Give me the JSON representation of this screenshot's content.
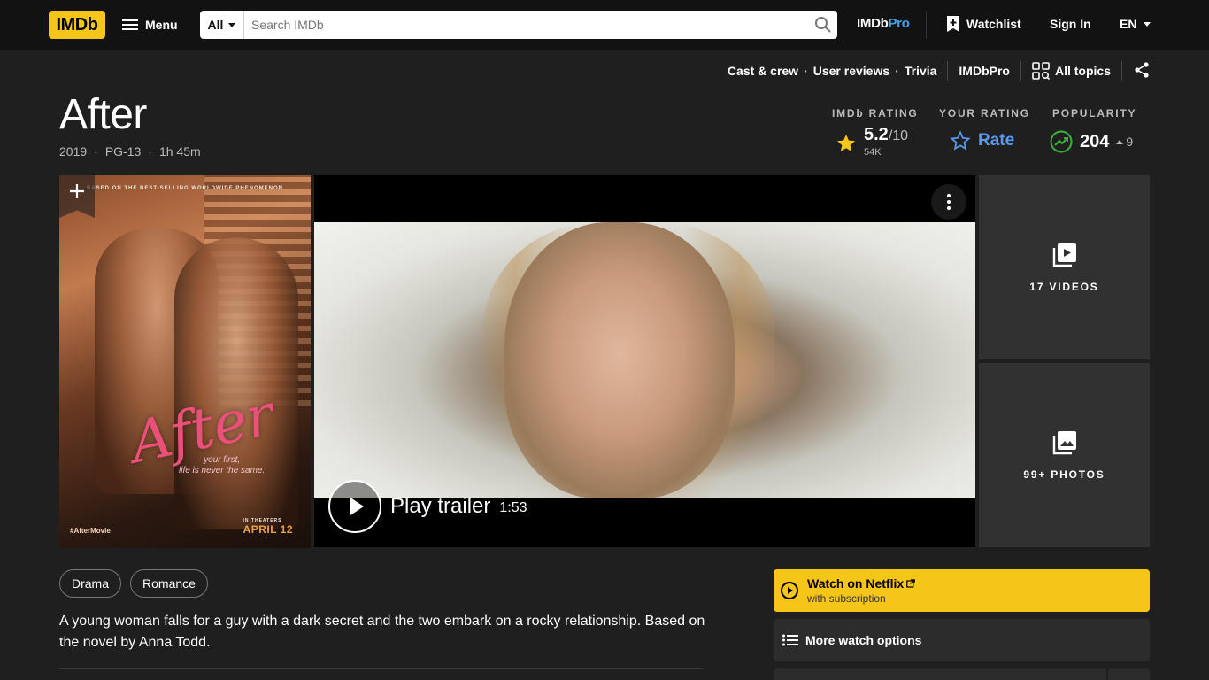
{
  "nav": {
    "logo": "IMDb",
    "menu_label": "Menu",
    "search_category": "All",
    "search_placeholder": "Search IMDb",
    "imdbpro_prefix": "IMDb",
    "imdbpro_suffix": "Pro",
    "watchlist_label": "Watchlist",
    "signin_label": "Sign In",
    "language": "EN"
  },
  "subnav": {
    "links": [
      "Cast & crew",
      "User reviews",
      "Trivia"
    ],
    "imdbpro": "IMDbPro",
    "all_topics": "All topics"
  },
  "title": {
    "name": "After",
    "year": "2019",
    "rating_cert": "PG-13",
    "runtime": "1h 45m"
  },
  "ratings": {
    "imdb_label": "IMDb RATING",
    "imdb_value": "5.2",
    "imdb_scale": "/10",
    "imdb_votes": "54K",
    "your_label": "YOUR RATING",
    "your_action": "Rate",
    "popularity_label": "POPULARITY",
    "popularity_value": "204",
    "popularity_change": "9"
  },
  "poster": {
    "tagline_top": "BASED ON THE BEST-SELLING WORLDWIDE PHENOMENON",
    "art_title": "After",
    "art_tagline_1": "your first,",
    "art_tagline_2": "life is never the same.",
    "hashtag": "#AfterMovie",
    "theaters": "IN THEATERS",
    "release_date": "APRIL 12"
  },
  "video": {
    "play_label": "Play trailer",
    "duration": "1:53"
  },
  "tiles": {
    "videos_label": "17 VIDEOS",
    "photos_label": "99+ PHOTOS"
  },
  "genres": [
    "Drama",
    "Romance"
  ],
  "plot": "A young woman falls for a guy with a dark secret and the two embark on a rocky relationship. Based on the novel by Anna Todd.",
  "watch": {
    "netflix_title": "Watch on Netflix",
    "netflix_sub": "with subscription",
    "more_options": "More watch options"
  },
  "colors": {
    "brand_yellow": "#f5c518",
    "link_blue": "#5799ef",
    "popularity_green": "#3bb33b",
    "background": "#1f1f1f",
    "nav_bg": "#121212"
  }
}
